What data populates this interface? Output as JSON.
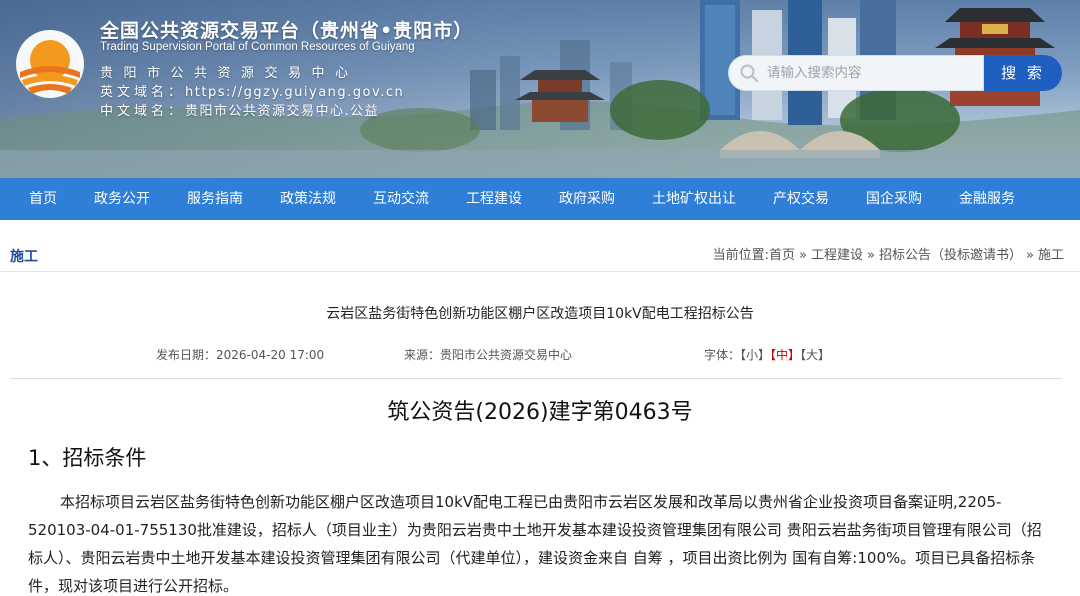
{
  "header": {
    "site_title": "全国公共资源交易平台（贵州省•贵阳市）",
    "site_subtitle_en": "Trading Supervision Portal of Common Resources of Guiyang",
    "center_name": "贵阳市公共资源交易中心",
    "domain_en_label": "英文域名：",
    "domain_en": "https://ggzy.guiyang.gov.cn",
    "domain_cn_label": "中文域名：",
    "domain_cn": "贵阳市公共资源交易中心.公益",
    "search": {
      "placeholder": "请输入搜索内容",
      "button_label": "搜 索"
    }
  },
  "nav": {
    "items": [
      {
        "label": "首页"
      },
      {
        "label": "政务公开"
      },
      {
        "label": "服务指南"
      },
      {
        "label": "政策法规"
      },
      {
        "label": "互动交流"
      },
      {
        "label": "工程建设"
      },
      {
        "label": "政府采购"
      },
      {
        "label": "土地矿权出让"
      },
      {
        "label": "产权交易"
      },
      {
        "label": "国企采购"
      },
      {
        "label": "金融服务"
      }
    ]
  },
  "section": {
    "label": "施工"
  },
  "breadcrumb": {
    "prefix": "当前位置:",
    "items": [
      "首页",
      "工程建设",
      "招标公告（投标邀请书）",
      "施工"
    ],
    "separator": "»"
  },
  "article": {
    "title": "云岩区盐务街特色创新功能区棚户区改造项目10kV配电工程招标公告",
    "publish_date_label": "发布日期：",
    "publish_date": "2026-04-20 17:00",
    "source_label": "来源：",
    "source": "贵阳市公共资源交易中心",
    "font_label": "字体：",
    "font_small": "【小】",
    "font_medium": "【中】",
    "font_large": "【大】",
    "doc_number": "筑公资告(2026)建字第0463号",
    "section_heading": "1、招标条件",
    "paragraph": "本招标项目云岩区盐务街特色创新功能区棚户区改造项目10kV配电工程已由贵阳市云岩区发展和改革局以贵州省企业投资项目备案证明,2205-520103-04-01-755130批准建设，招标人（项目业主）为贵阳云岩贵中土地开发基本建设投资管理集团有限公司 贵阳云岩盐务街项目管理有限公司（招标人）、贵阳云岩贵中土地开发基本建设投资管理集团有限公司（代建单位），建设资金来自 自筹 ，项目出资比例为 国有自筹:100%。项目已具备招标条件，现对该项目进行公开招标。"
  },
  "colors": {
    "nav_bg": "#2f7ed8",
    "search_button": "#1f5fbf",
    "section_label": "#1f4f9a",
    "font_medium_active": "#cc0000"
  }
}
